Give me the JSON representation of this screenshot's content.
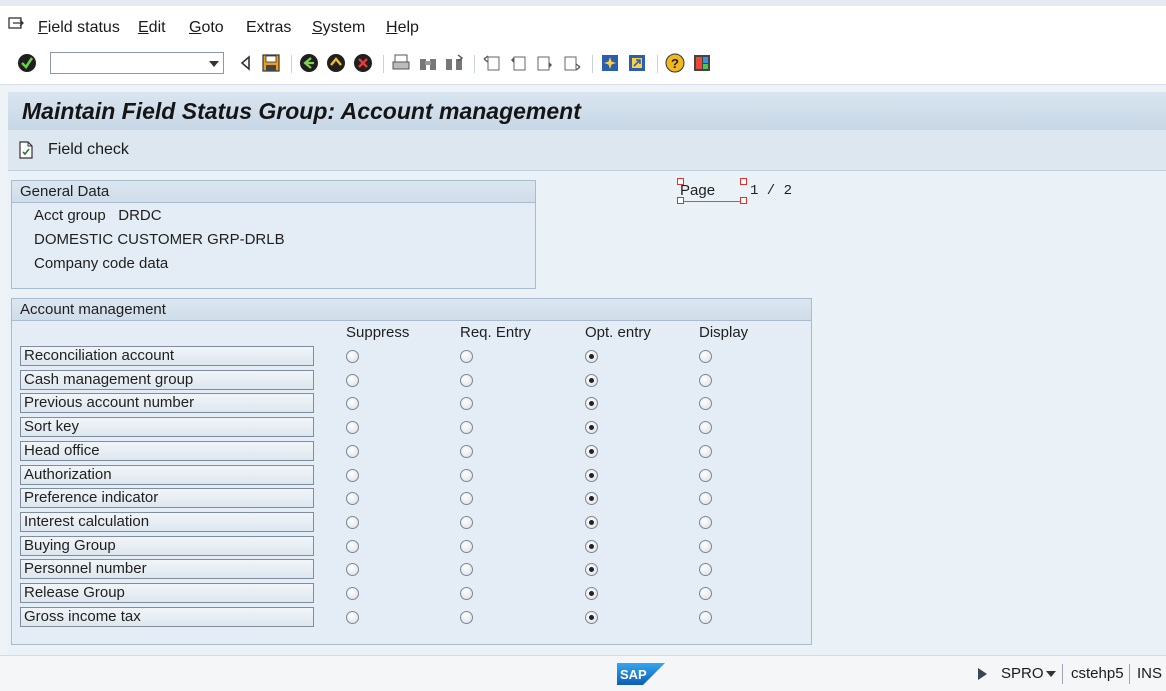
{
  "menu": {
    "items": [
      {
        "label": "Field status",
        "u": "F",
        "rest": "ield status"
      },
      {
        "label": "Edit",
        "u": "E",
        "rest": "dit"
      },
      {
        "label": "Goto",
        "u": "G",
        "rest": "oto"
      },
      {
        "label": "Extras",
        "u": "",
        "rest": "Extras"
      },
      {
        "label": "System",
        "u": "S",
        "rest": "ystem"
      },
      {
        "label": "Help",
        "u": "H",
        "rest": "elp"
      }
    ]
  },
  "toolbar": {
    "command_value": "",
    "icons": [
      "enter-icon",
      "back-icon",
      "save-icon",
      "green-back-icon",
      "exit-icon",
      "cancel-icon",
      "print-icon",
      "find-icon",
      "find-next-icon",
      "first-page-icon",
      "previous-page-icon",
      "next-page-icon",
      "last-page-icon",
      "create-session-icon",
      "shortcut-icon",
      "help-icon",
      "customize-layout-icon"
    ]
  },
  "title": "Maintain Field Status Group: Account management",
  "app_toolbar": {
    "field_check_label": "Field check"
  },
  "general_data": {
    "header": "General Data",
    "acct_group_label": "Acct group",
    "acct_group_value": "DRDC",
    "description": "DOMESTIC CUSTOMER GRP-DRLB",
    "company_code": "Company code data"
  },
  "page": {
    "label": "Page",
    "value": "1 / 2"
  },
  "account_management": {
    "header": "Account management",
    "columns": [
      "Suppress",
      "Req. Entry",
      "Opt. entry",
      "Display"
    ],
    "rows": [
      {
        "label": "Reconciliation account",
        "selected": 2
      },
      {
        "label": "Cash management group",
        "selected": 2
      },
      {
        "label": "Previous account number",
        "selected": 2
      },
      {
        "label": "Sort key",
        "selected": 2
      },
      {
        "label": "Head office",
        "selected": 2
      },
      {
        "label": "Authorization",
        "selected": 2
      },
      {
        "label": "Preference indicator",
        "selected": 2
      },
      {
        "label": "Interest calculation",
        "selected": 2
      },
      {
        "label": "Buying Group",
        "selected": 2
      },
      {
        "label": "Personnel number",
        "selected": 2
      },
      {
        "label": "Release Group",
        "selected": 2
      },
      {
        "label": "Gross income tax",
        "selected": 2
      }
    ]
  },
  "status_bar": {
    "system": "SPRO",
    "server": "cstehp5",
    "mode": "INS"
  },
  "colors": {
    "title_bg": "#c8d7e6",
    "group_border": "#a9bccf",
    "accent": "#0a6ed1"
  }
}
